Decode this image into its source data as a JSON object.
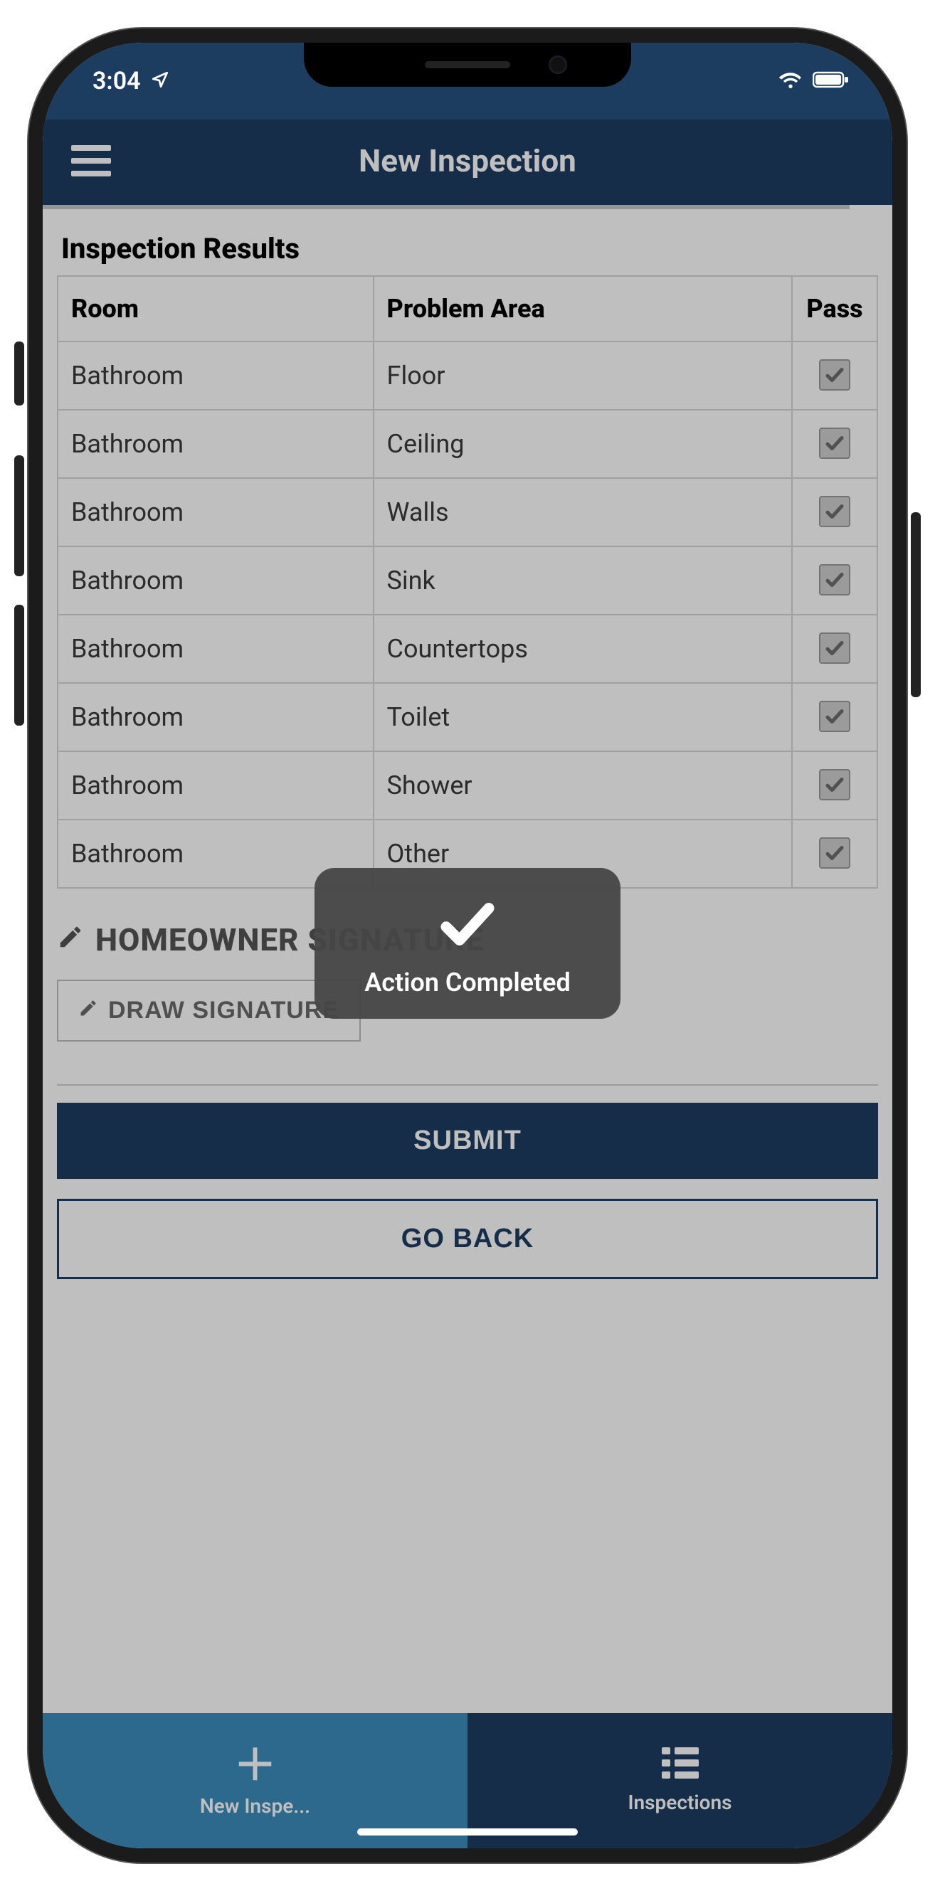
{
  "status": {
    "time": "3:04"
  },
  "nav": {
    "title": "New Inspection"
  },
  "section": {
    "title": "Inspection Results"
  },
  "table": {
    "headers": {
      "room": "Room",
      "problem": "Problem Area",
      "pass": "Pass"
    },
    "rows": [
      {
        "room": "Bathroom",
        "problem": "Floor",
        "pass": true
      },
      {
        "room": "Bathroom",
        "problem": "Ceiling",
        "pass": true
      },
      {
        "room": "Bathroom",
        "problem": "Walls",
        "pass": true
      },
      {
        "room": "Bathroom",
        "problem": "Sink",
        "pass": true
      },
      {
        "room": "Bathroom",
        "problem": "Countertops",
        "pass": true
      },
      {
        "room": "Bathroom",
        "problem": "Toilet",
        "pass": true
      },
      {
        "room": "Bathroom",
        "problem": "Shower",
        "pass": true
      },
      {
        "room": "Bathroom",
        "problem": "Other",
        "pass": true
      }
    ]
  },
  "signature": {
    "heading": "HOMEOWNER SIGNATURE",
    "draw_label": "DRAW SIGNATURE"
  },
  "buttons": {
    "submit": "SUBMIT",
    "go_back": "GO BACK"
  },
  "tabs": {
    "new_label": "New Inspe...",
    "list_label": "Inspections"
  },
  "toast": {
    "label": "Action Completed"
  },
  "colors": {
    "primary": "#1c3c60",
    "tab_active": "#3c8bbd"
  }
}
